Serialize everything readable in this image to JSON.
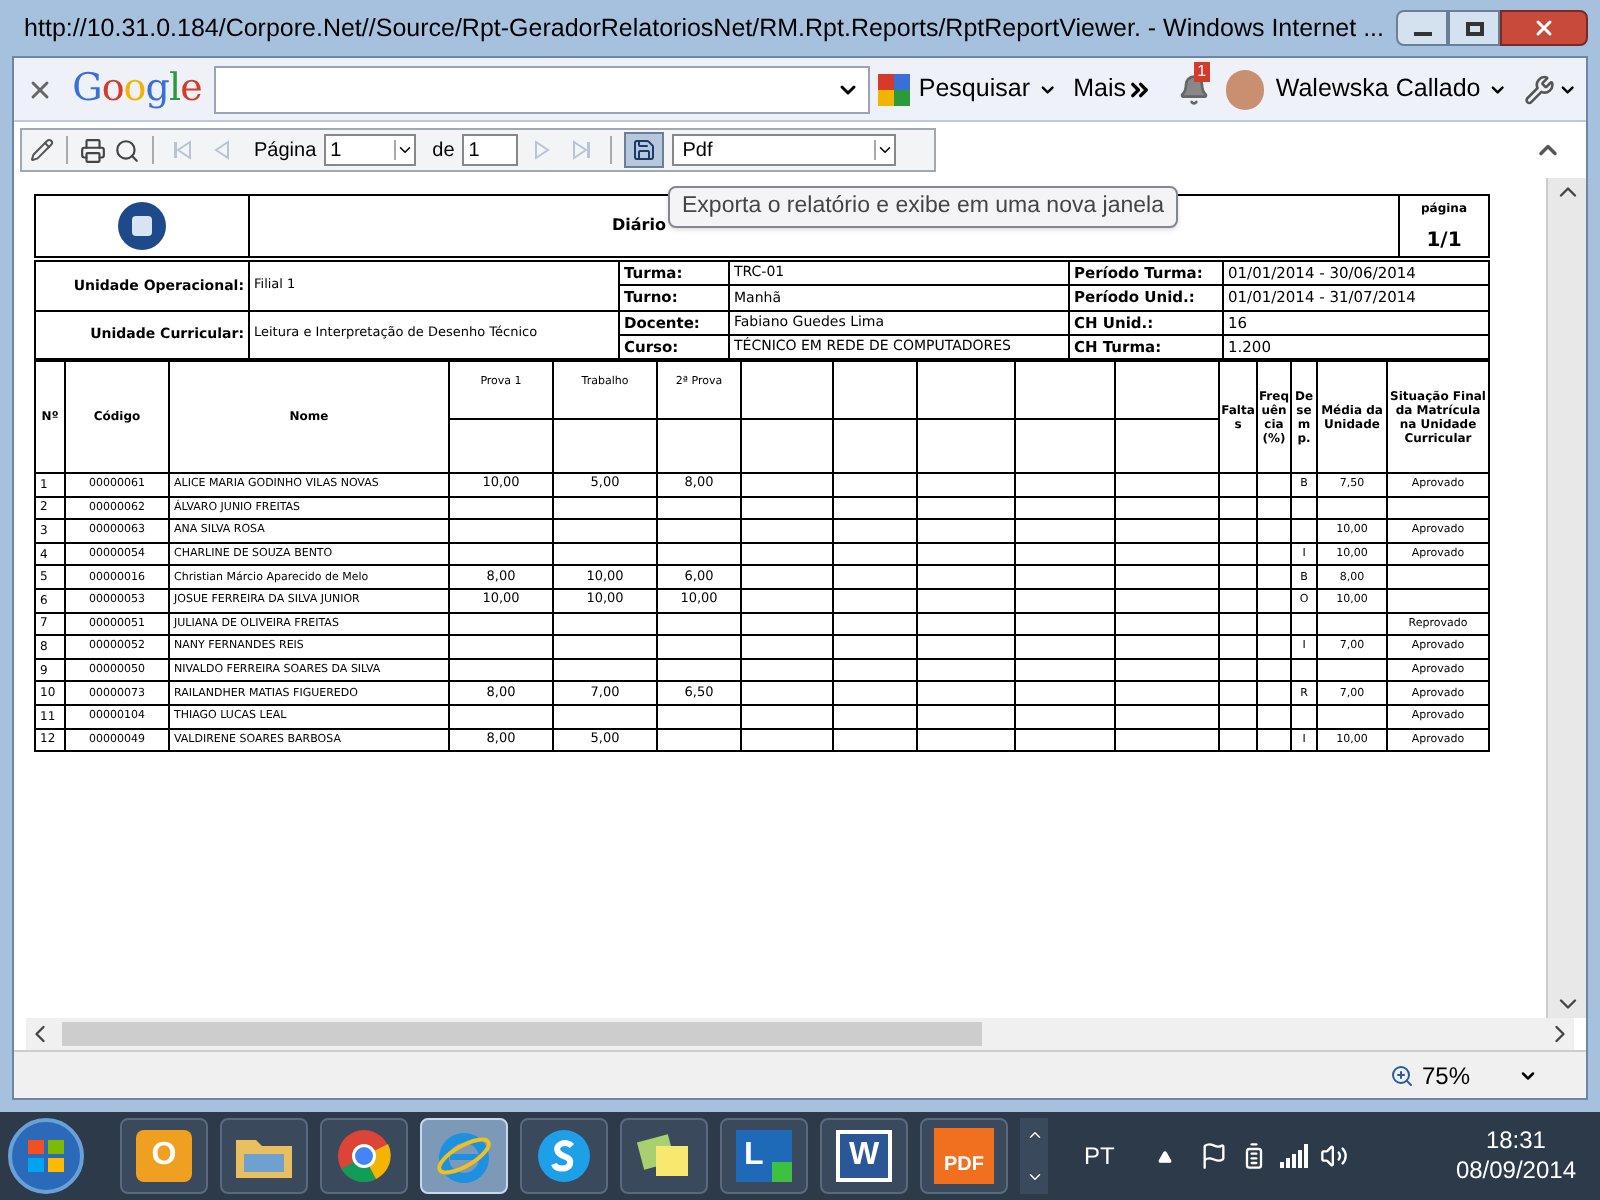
{
  "window": {
    "title": "http://10.31.0.184/Corpore.Net//Source/Rpt-GeradorRelatoriosNet/RM.Rpt.Reports/RptReportViewer. - Windows Internet ..."
  },
  "google_toolbar": {
    "logo": "Google",
    "search_button": "Pesquisar",
    "more": "Mais",
    "notification_count": "1",
    "user": "Walewska Callado"
  },
  "report_toolbar": {
    "page_label": "Página",
    "page": "1",
    "of_label": "de",
    "total": "1",
    "export_format": "Pdf",
    "nav_buttons": [
      {
        "kind": "first",
        "disabled": true
      },
      {
        "kind": "prev",
        "disabled": true
      },
      {
        "kind": "next",
        "disabled": true
      },
      {
        "kind": "last",
        "disabled": true
      }
    ]
  },
  "tooltip": "Exporta o relatório e exibe em uma nova janela",
  "report": {
    "title": "Diário",
    "page_label": "página",
    "page": "1/1",
    "left_info": [
      {
        "label": "Unidade Operacional:",
        "value": "Filial 1"
      },
      {
        "label": "Unidade Curricular:",
        "value": "Leitura e Interpretação de Desenho Técnico"
      }
    ],
    "right_info": [
      {
        "label": "Turma:",
        "value": "TRC-01",
        "label_2": "Período Turma:",
        "value_2": "01/01/2014 - 30/06/2014"
      },
      {
        "label": "Turno:",
        "value": "Manhã",
        "label_2": "Período Unid.:",
        "value_2": "01/01/2014 - 31/07/2014"
      },
      {
        "label": "Docente:",
        "value": "Fabiano Guedes Lima",
        "label_2": "CH Unid.:",
        "value_2": "16"
      },
      {
        "label": "Curso:",
        "value": "TÉCNICO EM REDE DE COMPUTADORES",
        "label_2": "CH Turma:",
        "value_2": "1.200"
      }
    ],
    "columns": [
      {
        "label": "Nº",
        "kind": "full"
      },
      {
        "label": "Código",
        "kind": "full"
      },
      {
        "label": "Nome",
        "kind": "full"
      },
      {
        "label": "Prova 1",
        "kind": "split"
      },
      {
        "label": "Trabalho",
        "kind": "split"
      },
      {
        "label": "2ª Prova",
        "kind": "split"
      },
      {
        "kind": "split"
      },
      {
        "kind": "split"
      },
      {
        "kind": "split"
      },
      {
        "kind": "split"
      },
      {
        "kind": "split"
      },
      {
        "label": "Faltas",
        "kind": "narrow"
      },
      {
        "label": "Frequência (%)",
        "kind": "narrow"
      },
      {
        "label": "Desemp.",
        "kind": "narrow"
      },
      {
        "label": "Média da Unidade",
        "kind": "full"
      },
      {
        "label": "Situação Final da Matrícula na Unidade Curricular",
        "kind": "full"
      }
    ],
    "rows": [
      {
        "no": "1",
        "code": "00000061",
        "name": "ALICE MARIA GODINHO VILAS NOVAS",
        "prova_1": "10,00",
        "trabalho": "5,00",
        "prova_2": "8,00",
        "desempenho": "B",
        "media": "7,50",
        "situacao": "Aprovado"
      },
      {
        "no": "2",
        "code": "00000062",
        "name": "ÁLVARO JUNIO FREITAS"
      },
      {
        "no": "3",
        "code": "00000063",
        "name": "ANA SILVA ROSA",
        "media": "10,00",
        "situacao": "Aprovado"
      },
      {
        "no": "4",
        "code": "00000054",
        "name": "CHARLINE DE SOUZA BENTO",
        "desempenho": "I",
        "media": "10,00",
        "situacao": "Aprovado"
      },
      {
        "no": "5",
        "code": "00000016",
        "name": "Christian Márcio Aparecido de Melo",
        "prova_1": "8,00",
        "trabalho": "10,00",
        "prova_2": "6,00",
        "desempenho": "B",
        "media": "8,00"
      },
      {
        "no": "6",
        "code": "00000053",
        "name": "JOSUE FERREIRA DA SILVA JUNIOR",
        "prova_1": "10,00",
        "trabalho": "10,00",
        "prova_2": "10,00",
        "desempenho": "O",
        "media": "10,00"
      },
      {
        "no": "7",
        "code": "00000051",
        "name": "JULIANA DE OLIVEIRA FREITAS",
        "situacao": "Reprovado"
      },
      {
        "no": "8",
        "code": "00000052",
        "name": "NANY FERNANDES REIS",
        "desempenho": "I",
        "media": "7,00",
        "situacao": "Aprovado"
      },
      {
        "no": "9",
        "code": "00000050",
        "name": "NIVALDO FERREIRA SOARES DA SILVA",
        "situacao": "Aprovado"
      },
      {
        "no": "10",
        "code": "00000073",
        "name": "RAILANDHER MATIAS FIGUEREDO",
        "prova_1": "8,00",
        "trabalho": "7,00",
        "prova_2": "6,50",
        "desempenho": "R",
        "media": "7,00",
        "situacao": "Aprovado"
      },
      {
        "no": "11",
        "code": "00000104",
        "name": "THIAGO LUCAS LEAL",
        "situacao": "Aprovado"
      },
      {
        "no": "12",
        "code": "00000049",
        "name": "VALDIRENE SOARES BARBOSA",
        "prova_1": "8,00",
        "trabalho": "5,00",
        "desempenho": "I",
        "media": "10,00",
        "situacao": "Aprovado"
      }
    ]
  },
  "status_bar": {
    "zoom": "75%"
  },
  "taskbar": {
    "apps": [
      {
        "kind": "mail",
        "label": "O",
        "selected": false
      },
      {
        "kind": "folder",
        "selected": false
      },
      {
        "kind": "chrome",
        "selected": false
      },
      {
        "kind": "ie",
        "selected": true
      },
      {
        "kind": "chat",
        "selected": false
      },
      {
        "kind": "notes",
        "selected": false
      },
      {
        "kind": "sync",
        "label": "L",
        "selected": false
      },
      {
        "kind": "word",
        "label": "W",
        "selected": false
      },
      {
        "kind": "pdf",
        "label": "PDF",
        "selected": false
      }
    ],
    "language": "PT",
    "time": "18:31",
    "date": "08/09/2014"
  }
}
